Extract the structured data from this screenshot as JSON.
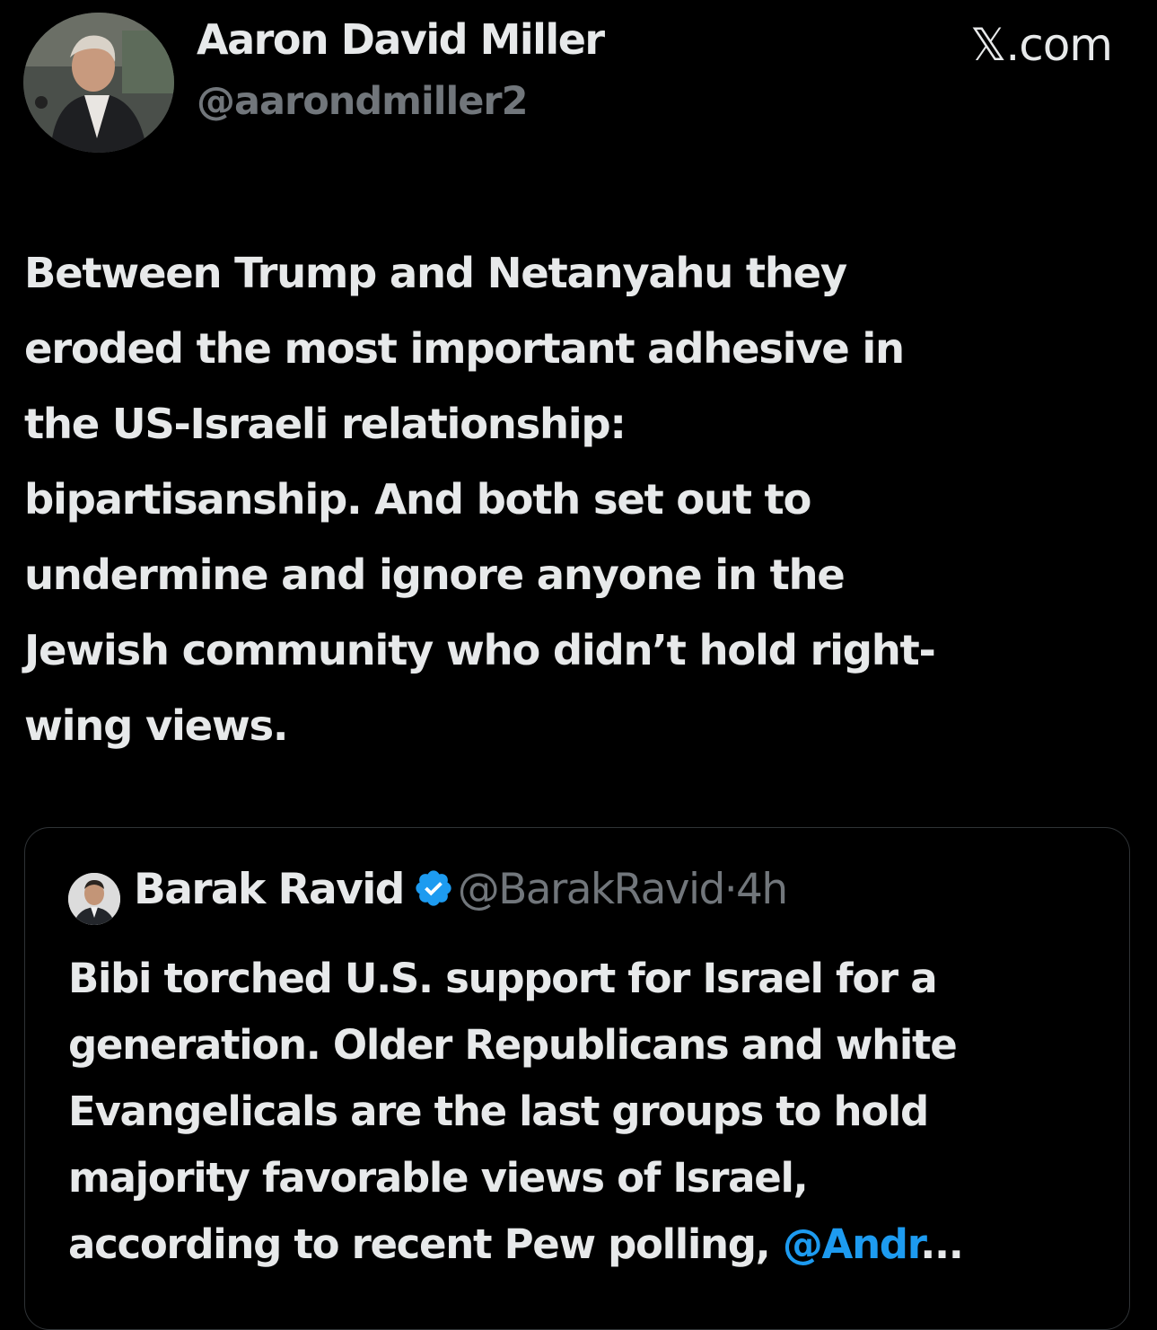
{
  "author": {
    "name": "Aaron David Miller",
    "handle": "@aarondmiller2",
    "avatar_icon": "profile-photo"
  },
  "site_label": "𝕏.com",
  "tweet": {
    "lines": [
      "Between Trump and Netanyahu they",
      "eroded the most important adhesive in",
      "the US-Israeli relationship:",
      "bipartisanship. And both set out to",
      "undermine and ignore anyone in the",
      "Jewish community who didn’t hold right-",
      "wing views."
    ]
  },
  "quoted_tweet": {
    "name": "Barak Ravid",
    "verified_icon": "verified-badge-icon",
    "handle": "@BarakRavid",
    "separator": "·",
    "time": "4h",
    "lines": [
      "Bibi torched U.S. support for Israel for a",
      "generation. Older Republicans and white",
      "Evangelicals are the last groups to hold",
      "majority favorable views of Israel,",
      "according to recent Pew polling, "
    ],
    "mention": "@Andr",
    "ellipsis": "..."
  },
  "colors": {
    "background": "#000000",
    "text_primary": "#e7e9ea",
    "text_secondary": "#71767b",
    "link": "#1d9bf0",
    "border": "#2f3336",
    "verified": "#1d9bf0"
  }
}
